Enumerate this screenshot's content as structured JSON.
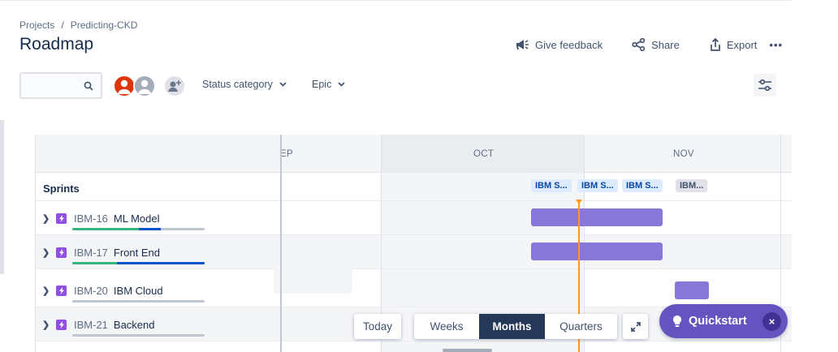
{
  "breadcrumb": {
    "projects": "Projects",
    "separator": "/",
    "project": "Predicting-CKD"
  },
  "page_title": "Roadmap",
  "header_actions": {
    "feedback": "Give feedback",
    "share": "Share",
    "export": "Export",
    "more": "•••"
  },
  "search": {
    "placeholder": ""
  },
  "filters": {
    "status": "Status category",
    "epic": "Epic"
  },
  "timeline": {
    "months": [
      "EP",
      "OCT",
      "NOV"
    ],
    "sprints_label": "Sprints",
    "sprints": [
      {
        "label": "IBM S...",
        "style": "blue"
      },
      {
        "label": "IBM S...",
        "style": "blue"
      },
      {
        "label": "IBM S...",
        "style": "blue"
      },
      {
        "label": "IBM...",
        "style": "gray"
      }
    ],
    "epics": [
      {
        "key": "IBM-16",
        "name": "ML Model",
        "progress": {
          "done": 0.5,
          "in_progress": 0.17
        }
      },
      {
        "key": "IBM-17",
        "name": "Front End",
        "progress": {
          "done": 0.34,
          "in_progress": 0.66
        }
      },
      {
        "key": "IBM-20",
        "name": "IBM Cloud",
        "progress": {
          "done": 0,
          "in_progress": 0
        }
      },
      {
        "key": "IBM-21",
        "name": "Backend",
        "progress": {
          "done": 0,
          "in_progress": 0
        }
      }
    ]
  },
  "controls": {
    "today": "Today",
    "weeks": "Weeks",
    "months": "Months",
    "quarters": "Quarters",
    "active": "Months"
  },
  "quickstart": {
    "label": "Quickstart",
    "close": "×"
  },
  "colors": {
    "epic_bar": "#8777d9",
    "today_marker": "#ff991f",
    "done": "#36b37e",
    "in_progress": "#0052cc",
    "quickstart": "#6554c0"
  }
}
